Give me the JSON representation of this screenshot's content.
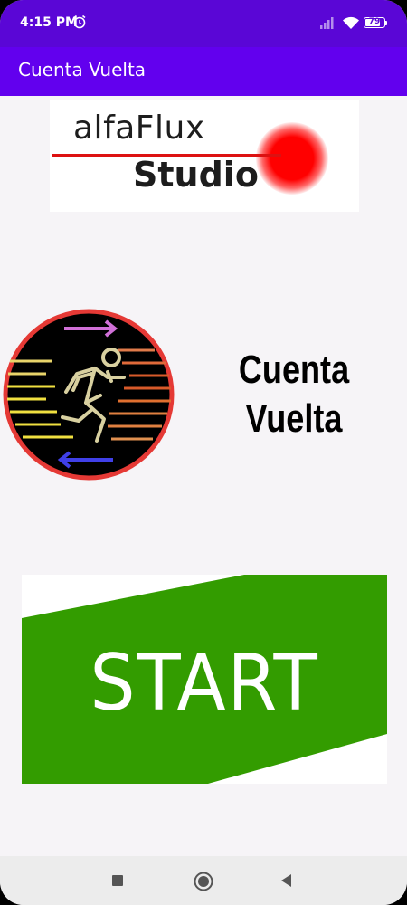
{
  "status_bar": {
    "time": "4:15 PM",
    "battery_level": "79",
    "battery_fraction": 0.79,
    "icons": [
      "alarm-icon",
      "signal-icon",
      "wifi-icon",
      "battery-icon"
    ]
  },
  "app_bar": {
    "title": "Cuenta Vuelta",
    "color": "#6200ee"
  },
  "studio_logo": {
    "line1": "alfaFlux",
    "line2": "Studio",
    "line_color": "#dd1111",
    "dot_color": "#ff0000"
  },
  "app_logo": {
    "icon": "running-man-icon",
    "border_color": "#e53935"
  },
  "app_name": {
    "line1": "Cuenta",
    "line2": "Vuelta"
  },
  "start_button": {
    "label": "START",
    "color": "#339c00"
  },
  "nav_bar": {
    "icons": [
      "recents-icon",
      "home-icon",
      "back-icon"
    ]
  }
}
